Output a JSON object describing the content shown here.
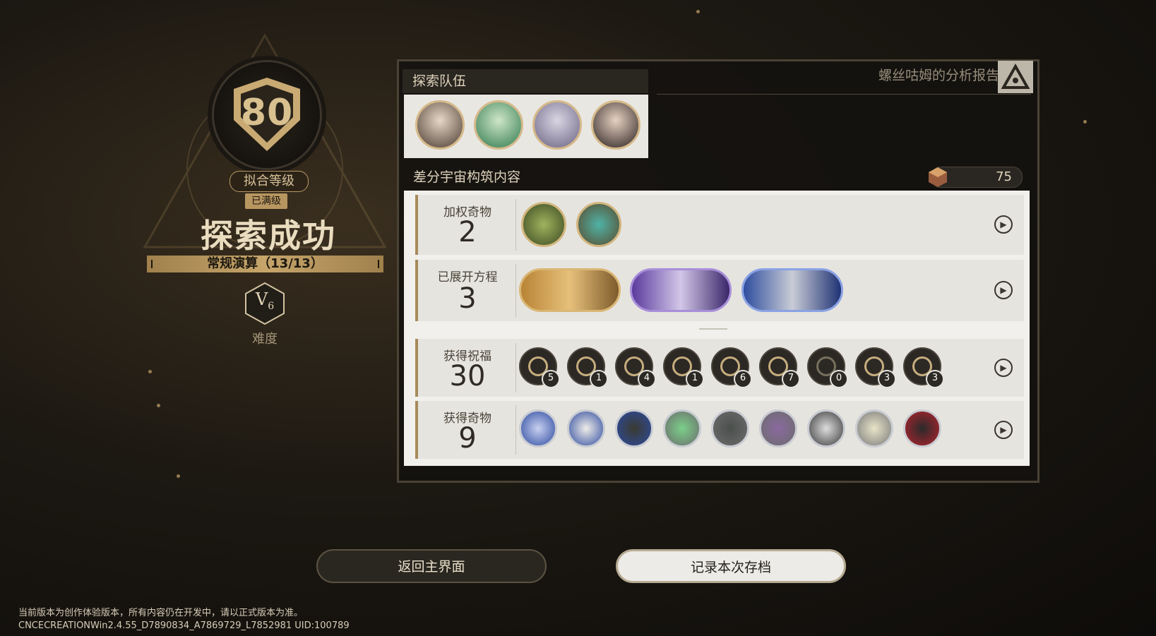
{
  "left": {
    "level": "80",
    "sync_label": "拟合等级",
    "maxed_label": "已满级",
    "result_title": "探索成功",
    "mode": "常规演算（13/13）",
    "difficulty": "V",
    "difficulty_sub": "6",
    "difficulty_label": "难度"
  },
  "panel": {
    "report_title": "螺丝咕姆的分析报告",
    "team_title": "探索队伍",
    "content_title": "差分宇宙构筑内容",
    "currency_value": "75",
    "rows": [
      {
        "label": "加权奇物",
        "count": "2"
      },
      {
        "label": "已展开方程",
        "count": "3"
      },
      {
        "label": "获得祝福",
        "count": "30"
      },
      {
        "label": "获得奇物",
        "count": "9"
      }
    ],
    "blessings": [
      "5",
      "1",
      "4",
      "1",
      "6",
      "7",
      "0",
      "3",
      "3"
    ]
  },
  "buttons": {
    "back": "返回主界面",
    "save": "记录本次存档"
  },
  "footer": {
    "line1": "当前版本为创作体验版本，所有内容仍在开发中，请以正式版本为准。",
    "line2": "CNCECREATIONWin2.4.55_D7890834_A7869729_L7852981 UID:100789"
  },
  "colors": {
    "gold": "#c6a56b",
    "panel_bg": "#f1f0ed",
    "dark": "#1c1812"
  }
}
